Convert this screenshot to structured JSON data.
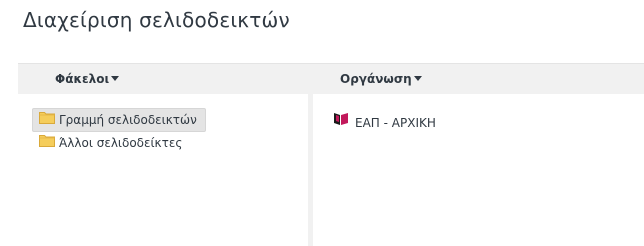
{
  "page": {
    "title": "Διαχείριση σελιδοδεικτών"
  },
  "toolbar": {
    "folders_label": "Φάκελοι",
    "organize_label": "Οργάνωση"
  },
  "tree": {
    "items": [
      {
        "label": "Γραμμή σελιδοδεικτών",
        "icon": "folder-icon",
        "selected": true
      },
      {
        "label": "Άλλοι σελιδοδείκτες",
        "icon": "folder-icon",
        "selected": false
      }
    ]
  },
  "list": {
    "items": [
      {
        "label": "ΕΑΠ - ΑΡΧΙΚΗ",
        "icon": "site-favicon"
      }
    ]
  },
  "colors": {
    "toolbar_bg": "#f1f1f1",
    "selected_bg": "#e4e4e4",
    "text": "#303942",
    "folder": "#f5cd5b",
    "favicon_magenta": "#c2185b"
  }
}
